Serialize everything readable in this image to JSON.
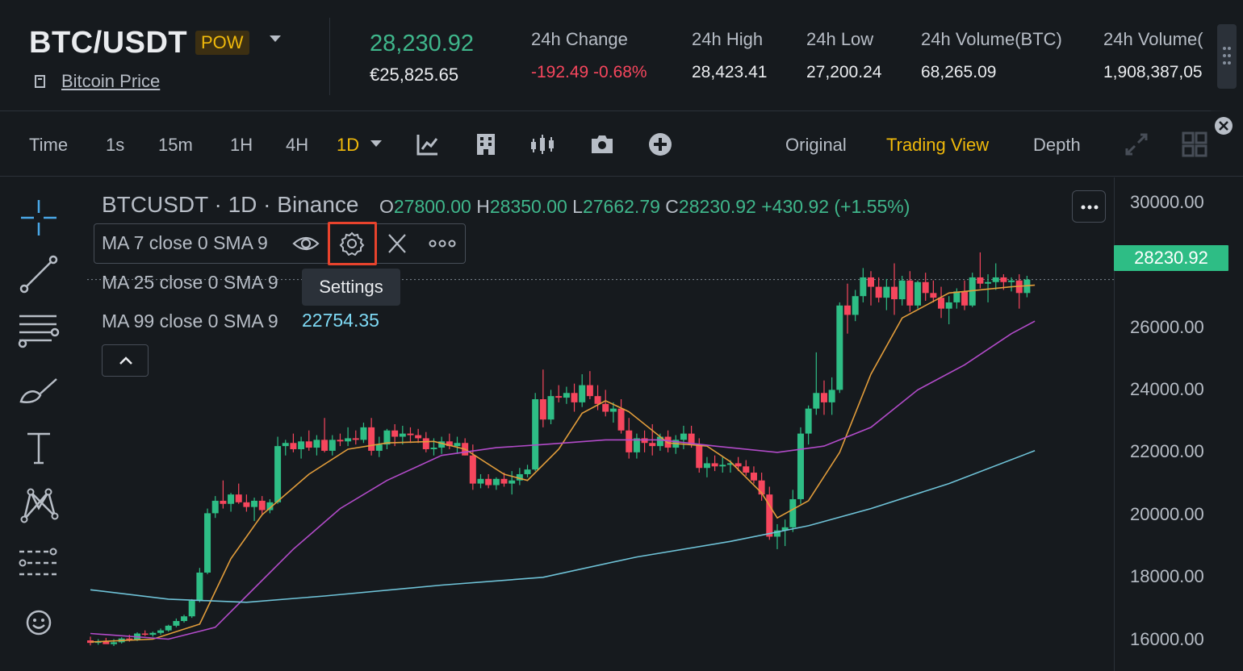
{
  "header": {
    "pair": "BTC/USDT",
    "tag": "POW",
    "info_link": "Bitcoin Price",
    "last_price": "28,230.92",
    "fiat_price": "€25,825.65",
    "stats": [
      {
        "label": "24h Change",
        "value": "-192.49 -0.68%",
        "tone": "neg"
      },
      {
        "label": "24h High",
        "value": "28,423.41",
        "tone": "neutral"
      },
      {
        "label": "24h Low",
        "value": "27,200.24",
        "tone": "neutral"
      },
      {
        "label": "24h Volume(BTC)",
        "value": "68,265.09",
        "tone": "neutral"
      },
      {
        "label": "24h Volume(",
        "value": "1,908,387,05",
        "tone": "neutral"
      }
    ]
  },
  "toolbar": {
    "timeframes": [
      "Time",
      "1s",
      "15m",
      "1H",
      "4H",
      "1D"
    ],
    "active_timeframe": "1D",
    "tool_icons": [
      "indicator-icon",
      "template-icon",
      "chart-type-icon",
      "screenshot-icon",
      "add-icon"
    ],
    "views": [
      "Original",
      "Trading View",
      "Depth"
    ],
    "active_view": "Trading View",
    "right_icons": [
      "fullscreen-icon",
      "layout-icon"
    ]
  },
  "left_tools": [
    "crosshair-icon",
    "trendline-icon",
    "horizontal-lines-icon",
    "brush-icon",
    "text-icon",
    "pattern-icon",
    "measure-icon",
    "emoji-icon"
  ],
  "legend": {
    "symbol": "BTCUSDT · 1D · Binance",
    "open_label": "O",
    "open": "27800.00",
    "high_label": "H",
    "high": "28350.00",
    "low_label": "L",
    "low": "27662.79",
    "close_label": "C",
    "close": "28230.92",
    "change": "+430.92 (+1.55%)",
    "ma_lines": [
      {
        "label": "MA 7 close 0 SMA 9",
        "value": ""
      },
      {
        "label": "MA 25 close 0 SMA 9",
        "value": ""
      },
      {
        "label": "MA 99 close 0 SMA 9",
        "value": "22754.35"
      }
    ],
    "tooltip": "Settings"
  },
  "colors": {
    "up": "#2ebd85",
    "down": "#f6465d",
    "ma7": "#e29d3b",
    "ma25": "#b24bc9",
    "ma99": "#6fc3d8",
    "accent": "#f0b90b"
  },
  "chart_data": {
    "type": "candlestick",
    "symbol": "BTCUSDT",
    "interval": "1D",
    "exchange": "Binance",
    "y_ticks": [
      "30000.00",
      "26000.00",
      "24000.00",
      "22000.00",
      "20000.00",
      "18000.00",
      "16000.00"
    ],
    "ylim": [
      15700,
      31500
    ],
    "last_price_tag": "28230.92",
    "candles": [
      {
        "o": 16680,
        "h": 16800,
        "l": 16520,
        "c": 16600
      },
      {
        "o": 16600,
        "h": 16720,
        "l": 16540,
        "c": 16640
      },
      {
        "o": 16640,
        "h": 16760,
        "l": 16580,
        "c": 16560
      },
      {
        "o": 16560,
        "h": 16720,
        "l": 16500,
        "c": 16620
      },
      {
        "o": 16620,
        "h": 16780,
        "l": 16580,
        "c": 16740
      },
      {
        "o": 16740,
        "h": 16860,
        "l": 16640,
        "c": 16700
      },
      {
        "o": 16700,
        "h": 16940,
        "l": 16660,
        "c": 16900
      },
      {
        "o": 16900,
        "h": 17000,
        "l": 16820,
        "c": 16860
      },
      {
        "o": 16860,
        "h": 16960,
        "l": 16800,
        "c": 16920
      },
      {
        "o": 16920,
        "h": 17060,
        "l": 16860,
        "c": 17000
      },
      {
        "o": 17000,
        "h": 17180,
        "l": 16960,
        "c": 17150
      },
      {
        "o": 17150,
        "h": 17380,
        "l": 17100,
        "c": 17300
      },
      {
        "o": 17300,
        "h": 17500,
        "l": 17250,
        "c": 17450
      },
      {
        "o": 17450,
        "h": 18000,
        "l": 17400,
        "c": 17950
      },
      {
        "o": 17950,
        "h": 19000,
        "l": 17900,
        "c": 18850
      },
      {
        "o": 18850,
        "h": 20900,
        "l": 18800,
        "c": 20750
      },
      {
        "o": 20750,
        "h": 21300,
        "l": 20600,
        "c": 21150
      },
      {
        "o": 21150,
        "h": 21800,
        "l": 20900,
        "c": 21050
      },
      {
        "o": 21050,
        "h": 21400,
        "l": 20800,
        "c": 21350
      },
      {
        "o": 21350,
        "h": 21700,
        "l": 21050,
        "c": 21100
      },
      {
        "o": 21100,
        "h": 21350,
        "l": 20800,
        "c": 20950
      },
      {
        "o": 20950,
        "h": 21250,
        "l": 20500,
        "c": 21150
      },
      {
        "o": 21150,
        "h": 21300,
        "l": 20700,
        "c": 20850
      },
      {
        "o": 20850,
        "h": 21200,
        "l": 20750,
        "c": 21100
      },
      {
        "o": 21100,
        "h": 23200,
        "l": 21050,
        "c": 22900
      },
      {
        "o": 22900,
        "h": 23100,
        "l": 22600,
        "c": 23000
      },
      {
        "o": 23000,
        "h": 23300,
        "l": 22700,
        "c": 22800
      },
      {
        "o": 22800,
        "h": 23200,
        "l": 22500,
        "c": 23050
      },
      {
        "o": 23050,
        "h": 23400,
        "l": 22750,
        "c": 22850
      },
      {
        "o": 22850,
        "h": 23250,
        "l": 22600,
        "c": 23100
      },
      {
        "o": 23100,
        "h": 23800,
        "l": 22700,
        "c": 22750
      },
      {
        "o": 22750,
        "h": 23250,
        "l": 22600,
        "c": 23100
      },
      {
        "o": 23100,
        "h": 23300,
        "l": 22900,
        "c": 23050
      },
      {
        "o": 23050,
        "h": 23500,
        "l": 22900,
        "c": 23150
      },
      {
        "o": 23150,
        "h": 23400,
        "l": 22950,
        "c": 23100
      },
      {
        "o": 23100,
        "h": 23650,
        "l": 23000,
        "c": 23500
      },
      {
        "o": 23500,
        "h": 23800,
        "l": 22600,
        "c": 22750
      },
      {
        "o": 22750,
        "h": 23200,
        "l": 22550,
        "c": 22950
      },
      {
        "o": 22950,
        "h": 23450,
        "l": 22800,
        "c": 23400
      },
      {
        "o": 23400,
        "h": 23600,
        "l": 22900,
        "c": 23200
      },
      {
        "o": 23200,
        "h": 23550,
        "l": 22950,
        "c": 23300
      },
      {
        "o": 23300,
        "h": 23500,
        "l": 23000,
        "c": 23250
      },
      {
        "o": 23250,
        "h": 23450,
        "l": 23000,
        "c": 23150
      },
      {
        "o": 23150,
        "h": 23350,
        "l": 22700,
        "c": 22800
      },
      {
        "o": 22800,
        "h": 23150,
        "l": 22600,
        "c": 22850
      },
      {
        "o": 22850,
        "h": 23200,
        "l": 22650,
        "c": 23050
      },
      {
        "o": 23050,
        "h": 23300,
        "l": 22800,
        "c": 22900
      },
      {
        "o": 22900,
        "h": 23200,
        "l": 22650,
        "c": 23000
      },
      {
        "o": 23000,
        "h": 23150,
        "l": 22600,
        "c": 22600
      },
      {
        "o": 22600,
        "h": 22950,
        "l": 21500,
        "c": 21700
      },
      {
        "o": 21700,
        "h": 22000,
        "l": 21550,
        "c": 21850
      },
      {
        "o": 21850,
        "h": 22000,
        "l": 21550,
        "c": 21650
      },
      {
        "o": 21650,
        "h": 21900,
        "l": 21500,
        "c": 21850
      },
      {
        "o": 21850,
        "h": 22050,
        "l": 21600,
        "c": 21700
      },
      {
        "o": 21700,
        "h": 22100,
        "l": 21350,
        "c": 21800
      },
      {
        "o": 21800,
        "h": 22200,
        "l": 21650,
        "c": 22000
      },
      {
        "o": 22000,
        "h": 22300,
        "l": 21900,
        "c": 22150
      },
      {
        "o": 22150,
        "h": 24600,
        "l": 22100,
        "c": 24400
      },
      {
        "o": 24400,
        "h": 25350,
        "l": 23500,
        "c": 23750
      },
      {
        "o": 23750,
        "h": 24700,
        "l": 23600,
        "c": 24500
      },
      {
        "o": 24500,
        "h": 24850,
        "l": 24300,
        "c": 24450
      },
      {
        "o": 24450,
        "h": 24800,
        "l": 24250,
        "c": 24600
      },
      {
        "o": 24600,
        "h": 24900,
        "l": 24000,
        "c": 24300
      },
      {
        "o": 24300,
        "h": 25200,
        "l": 24150,
        "c": 24850
      },
      {
        "o": 24850,
        "h": 25300,
        "l": 24400,
        "c": 24500
      },
      {
        "o": 24500,
        "h": 24850,
        "l": 24050,
        "c": 24250
      },
      {
        "o": 24250,
        "h": 24700,
        "l": 23850,
        "c": 24000
      },
      {
        "o": 24000,
        "h": 24300,
        "l": 23650,
        "c": 24100
      },
      {
        "o": 24100,
        "h": 24400,
        "l": 23300,
        "c": 23400
      },
      {
        "o": 23400,
        "h": 23800,
        "l": 22500,
        "c": 22700
      },
      {
        "o": 22700,
        "h": 23300,
        "l": 22500,
        "c": 23150
      },
      {
        "o": 23150,
        "h": 23400,
        "l": 22700,
        "c": 23000
      },
      {
        "o": 23000,
        "h": 23600,
        "l": 22600,
        "c": 22900
      },
      {
        "o": 22900,
        "h": 23300,
        "l": 22750,
        "c": 23200
      },
      {
        "o": 23200,
        "h": 23400,
        "l": 22700,
        "c": 22850
      },
      {
        "o": 22850,
        "h": 23250,
        "l": 22650,
        "c": 23100
      },
      {
        "o": 23100,
        "h": 23550,
        "l": 22800,
        "c": 23300
      },
      {
        "o": 23300,
        "h": 23550,
        "l": 22850,
        "c": 22950
      },
      {
        "o": 22950,
        "h": 23150,
        "l": 22050,
        "c": 22200
      },
      {
        "o": 22200,
        "h": 22550,
        "l": 21900,
        "c": 22350
      },
      {
        "o": 22350,
        "h": 22600,
        "l": 22100,
        "c": 22250
      },
      {
        "o": 22250,
        "h": 22550,
        "l": 22050,
        "c": 22300
      },
      {
        "o": 22300,
        "h": 22450,
        "l": 22050,
        "c": 22350
      },
      {
        "o": 22350,
        "h": 22550,
        "l": 22100,
        "c": 22250
      },
      {
        "o": 22250,
        "h": 22450,
        "l": 21950,
        "c": 22050
      },
      {
        "o": 22050,
        "h": 22250,
        "l": 21700,
        "c": 21800
      },
      {
        "o": 21800,
        "h": 22050,
        "l": 21150,
        "c": 21350
      },
      {
        "o": 21350,
        "h": 21600,
        "l": 19900,
        "c": 20000
      },
      {
        "o": 20000,
        "h": 20400,
        "l": 19600,
        "c": 20200
      },
      {
        "o": 20200,
        "h": 20550,
        "l": 19700,
        "c": 20300
      },
      {
        "o": 20300,
        "h": 21500,
        "l": 20150,
        "c": 21200
      },
      {
        "o": 21200,
        "h": 23500,
        "l": 21050,
        "c": 23300
      },
      {
        "o": 23300,
        "h": 24200,
        "l": 22950,
        "c": 24100
      },
      {
        "o": 24100,
        "h": 25900,
        "l": 23900,
        "c": 24600
      },
      {
        "o": 24600,
        "h": 25000,
        "l": 23900,
        "c": 24300
      },
      {
        "o": 24300,
        "h": 25100,
        "l": 23900,
        "c": 24700
      },
      {
        "o": 24700,
        "h": 27500,
        "l": 24600,
        "c": 27400
      },
      {
        "o": 27400,
        "h": 28100,
        "l": 26500,
        "c": 27100
      },
      {
        "o": 27100,
        "h": 27900,
        "l": 26900,
        "c": 27700
      },
      {
        "o": 27700,
        "h": 28600,
        "l": 27500,
        "c": 28300
      },
      {
        "o": 28300,
        "h": 28500,
        "l": 27400,
        "c": 28000
      },
      {
        "o": 28000,
        "h": 28300,
        "l": 27500,
        "c": 27650
      },
      {
        "o": 27650,
        "h": 28250,
        "l": 27250,
        "c": 28000
      },
      {
        "o": 28000,
        "h": 28750,
        "l": 27100,
        "c": 27600
      },
      {
        "o": 27600,
        "h": 28350,
        "l": 27400,
        "c": 28200
      },
      {
        "o": 28200,
        "h": 28500,
        "l": 27200,
        "c": 27400
      },
      {
        "o": 27400,
        "h": 28200,
        "l": 27300,
        "c": 28150
      },
      {
        "o": 28150,
        "h": 28450,
        "l": 27550,
        "c": 27800
      },
      {
        "o": 27800,
        "h": 28200,
        "l": 27500,
        "c": 27650
      },
      {
        "o": 27650,
        "h": 28000,
        "l": 27000,
        "c": 27300
      },
      {
        "o": 27300,
        "h": 27700,
        "l": 26800,
        "c": 27500
      },
      {
        "o": 27500,
        "h": 27950,
        "l": 27300,
        "c": 27850
      },
      {
        "o": 27850,
        "h": 28200,
        "l": 27250,
        "c": 27400
      },
      {
        "o": 27400,
        "h": 28450,
        "l": 27350,
        "c": 28300
      },
      {
        "o": 28300,
        "h": 29100,
        "l": 27950,
        "c": 28100
      },
      {
        "o": 28100,
        "h": 28400,
        "l": 27500,
        "c": 28150
      },
      {
        "o": 28150,
        "h": 28750,
        "l": 27900,
        "c": 28300
      },
      {
        "o": 28300,
        "h": 28400,
        "l": 27900,
        "c": 28150
      },
      {
        "o": 28150,
        "h": 28300,
        "l": 27850,
        "c": 28200
      },
      {
        "o": 28200,
        "h": 28400,
        "l": 27300,
        "c": 27800
      },
      {
        "o": 27800,
        "h": 28350,
        "l": 27662.79,
        "c": 28230.92
      }
    ],
    "ma_series": [
      {
        "name": "MA 7",
        "points": [
          [
            0,
            16630
          ],
          [
            8,
            16720
          ],
          [
            14,
            17200
          ],
          [
            18,
            19300
          ],
          [
            22,
            20700
          ],
          [
            28,
            22000
          ],
          [
            33,
            22800
          ],
          [
            38,
            23000
          ],
          [
            44,
            23050
          ],
          [
            48,
            22800
          ],
          [
            53,
            22000
          ],
          [
            56,
            21800
          ],
          [
            60,
            22800
          ],
          [
            63,
            23950
          ],
          [
            66,
            24350
          ],
          [
            69,
            24000
          ],
          [
            74,
            23000
          ],
          [
            79,
            22900
          ],
          [
            82,
            22400
          ],
          [
            86,
            21400
          ],
          [
            88,
            20600
          ],
          [
            92,
            21150
          ],
          [
            96,
            22700
          ],
          [
            100,
            25200
          ],
          [
            104,
            27000
          ],
          [
            110,
            27800
          ],
          [
            118,
            28000
          ],
          [
            121,
            28050
          ]
        ]
      },
      {
        "name": "MA 25",
        "points": [
          [
            0,
            16900
          ],
          [
            10,
            16720
          ],
          [
            16,
            17100
          ],
          [
            20,
            18100
          ],
          [
            26,
            19600
          ],
          [
            32,
            20900
          ],
          [
            38,
            21800
          ],
          [
            45,
            22600
          ],
          [
            52,
            22850
          ],
          [
            58,
            22950
          ],
          [
            66,
            23100
          ],
          [
            73,
            23100
          ],
          [
            80,
            22900
          ],
          [
            88,
            22700
          ],
          [
            94,
            22900
          ],
          [
            100,
            23500
          ],
          [
            106,
            24700
          ],
          [
            112,
            25500
          ],
          [
            118,
            26500
          ],
          [
            121,
            26900
          ]
        ]
      },
      {
        "name": "MA 99",
        "points": [
          [
            0,
            18300
          ],
          [
            10,
            18000
          ],
          [
            20,
            17900
          ],
          [
            30,
            18100
          ],
          [
            45,
            18450
          ],
          [
            58,
            18700
          ],
          [
            70,
            19350
          ],
          [
            82,
            19850
          ],
          [
            92,
            20350
          ],
          [
            100,
            20900
          ],
          [
            110,
            21700
          ],
          [
            121,
            22754.35
          ]
        ]
      }
    ]
  }
}
